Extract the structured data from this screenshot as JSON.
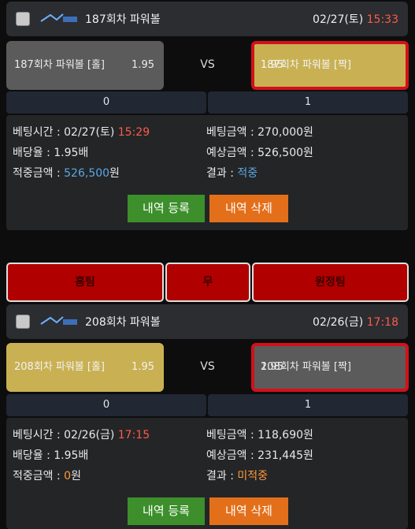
{
  "card1": {
    "title": "187회차 파워볼",
    "date": "02/27(토)",
    "time": "15:33",
    "left_label": "187회차 파워볼 [홀]",
    "left_odd": "1.95",
    "vs": "VS",
    "right_label": "187회차 파워볼 [짝]",
    "right_odd": "1.95",
    "count_left": "0",
    "count_right": "1",
    "bet_time_label": "베팅시간 : ",
    "bet_time_date": "02/27(토) ",
    "bet_time_clock": "15:29",
    "bet_amount": "베팅금액 : 270,000원",
    "odds": "배당율 : 1.95배",
    "expected": "예상금액 : 526,500원",
    "win_label": "적중금액 : ",
    "win_value": "526,500",
    "win_unit": "원",
    "result_label": "결과 : ",
    "result_value": "적중",
    "btn_register": "내역 등록",
    "btn_delete": "내역 삭제"
  },
  "bar": {
    "home": "홈팀",
    "draw": "무",
    "away": "원정팀"
  },
  "card2": {
    "title": "208회차 파워볼",
    "date": "02/26(금)",
    "time": "17:18",
    "left_label": "208회차 파워볼 [홀]",
    "left_odd": "1.95",
    "vs": "VS",
    "right_label": "208회차 파워볼 [짝]",
    "right_odd": "1.95",
    "count_left": "0",
    "count_right": "1",
    "bet_time_label": "베팅시간 : ",
    "bet_time_date": "02/26(금) ",
    "bet_time_clock": "17:15",
    "bet_amount": "베팅금액 : 118,690원",
    "odds": "배당율 : 1.95배",
    "expected": "예상금액 : 231,445원",
    "win_label": "적중금액 : ",
    "win_value": "0",
    "win_unit": "원",
    "result_label": "결과 : ",
    "result_value": "미적중",
    "btn_register": "내역 등록",
    "btn_delete": "내역 삭제"
  },
  "colors": {
    "red": "#d4101a",
    "gold": "#c9b153",
    "grey": "#5b5b5b",
    "green": "#3c8f2b",
    "orange": "#e46f1a"
  }
}
